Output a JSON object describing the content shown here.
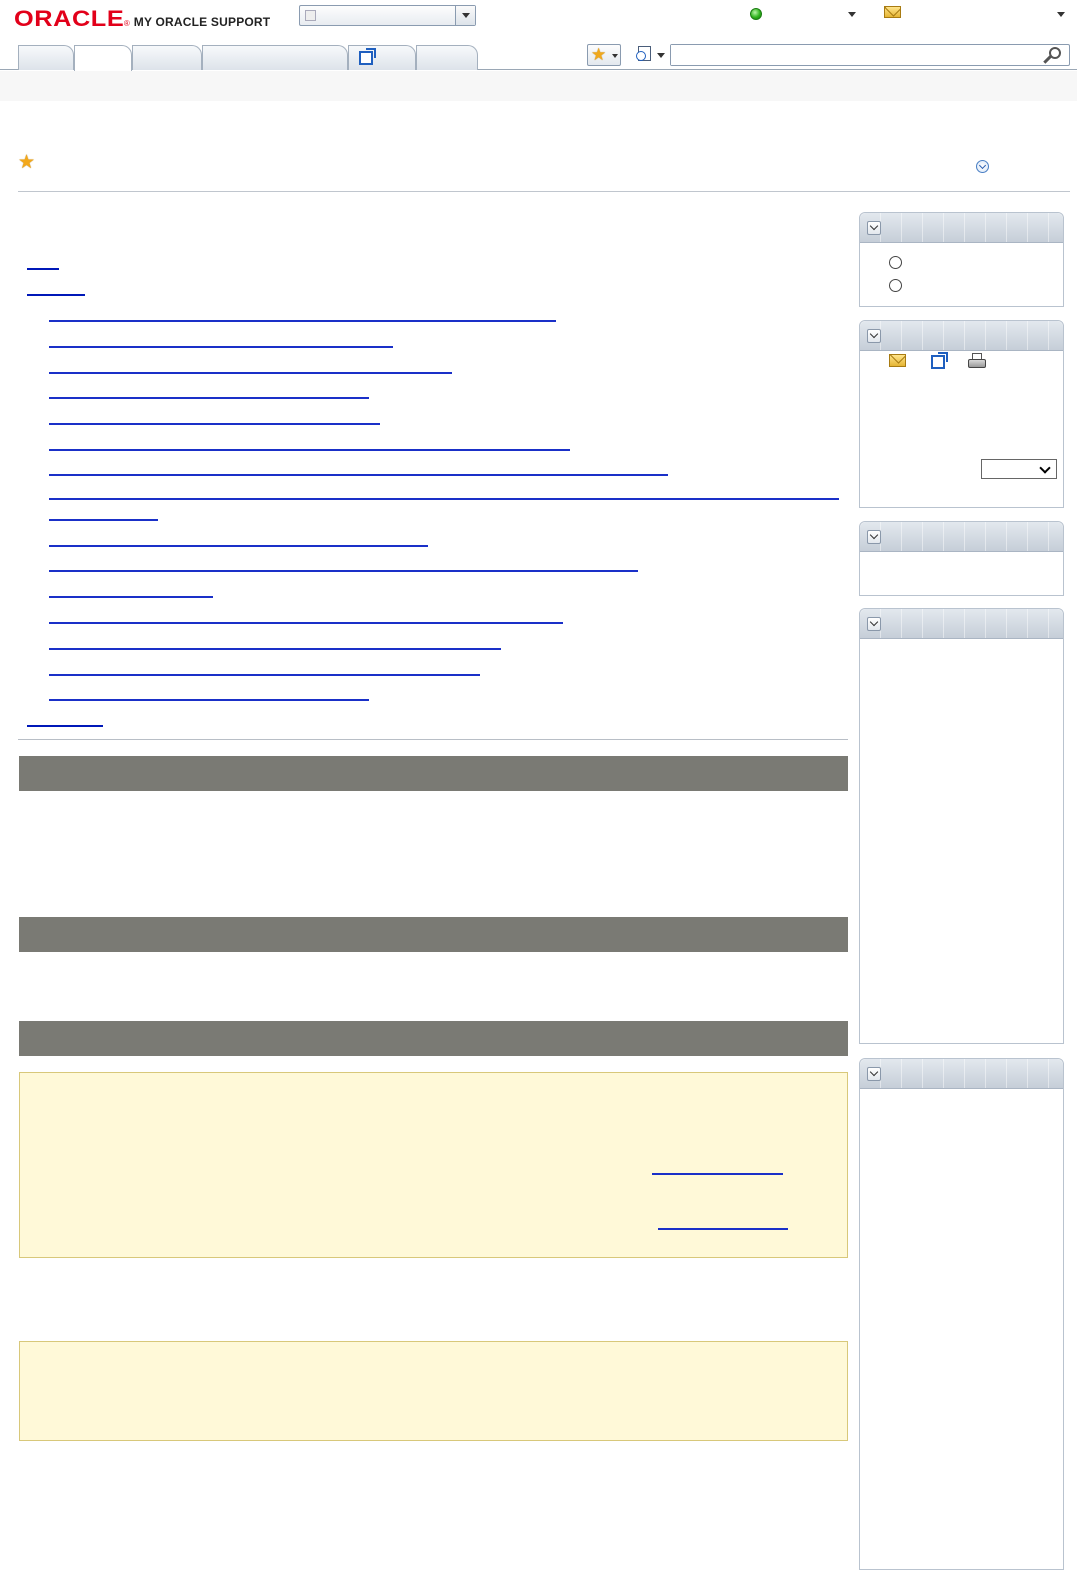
{
  "header": {
    "brand_word": "ORACLE",
    "brand_registered": "®",
    "brand_product": "MY ORACLE SUPPORT",
    "context_selector_value": "",
    "user_status_label": "",
    "messages_label": ""
  },
  "tabs": [
    {
      "label": "",
      "active": false
    },
    {
      "label": "",
      "active": true
    },
    {
      "label": "",
      "active": false
    },
    {
      "label": "",
      "active": false
    },
    {
      "label": "",
      "active": false,
      "external": true
    },
    {
      "label": "",
      "active": false
    }
  ],
  "search": {
    "value": "",
    "placeholder": "",
    "favorites_icon": "star-icon",
    "scope_icon": "recent-docs-icon",
    "go_icon": "magnifier-icon"
  },
  "document": {
    "title": "",
    "favorite_icon": "star-icon",
    "options_icon": "chevron-circle-icon"
  },
  "toc": {
    "link_color": "#1a30c8"
  },
  "sections": [
    {
      "heading": ""
    },
    {
      "heading": ""
    },
    {
      "heading": ""
    }
  ],
  "notes": {
    "background": "#fff9d8",
    "border": "#d8c87a"
  },
  "sidebar": {
    "panels": [
      {
        "title": "",
        "toggle_icon": "chevron-down-icon",
        "radio_options": [
          "",
          ""
        ]
      },
      {
        "title": "",
        "toggle_icon": "chevron-down-icon",
        "tools": [
          "mail-icon",
          "external-link-icon",
          "print-icon"
        ],
        "language_value": ""
      },
      {
        "title": "",
        "toggle_icon": "chevron-down-icon"
      },
      {
        "title": "",
        "toggle_icon": "chevron-down-icon"
      },
      {
        "title": "",
        "toggle_icon": "chevron-down-icon"
      }
    ]
  },
  "colors": {
    "brand_red": "#e2001a",
    "section_bar": "#7a7a74",
    "status_online": "#2fb31c",
    "panel_border": "#b9c3cf"
  }
}
